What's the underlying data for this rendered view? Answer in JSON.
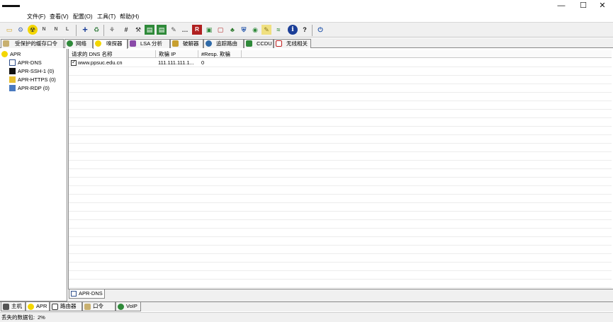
{
  "window": {
    "minimize": "—",
    "maximize": "☐",
    "close": "✕"
  },
  "menu": [
    "文件(F)",
    "查看(V)",
    "配置(O)",
    "工具(T)",
    "帮助(H)"
  ],
  "toolbar": {
    "buttons": [
      {
        "name": "open-icon",
        "glyph": "▭",
        "color": "#e8c44a"
      },
      {
        "name": "network-icon",
        "glyph": "⚙",
        "color": "#6a8cc7"
      },
      {
        "name": "sniffer-icon",
        "glyph": "☢",
        "color": "#f0d000"
      },
      {
        "name": "ntlm-auth-icon",
        "glyph": "N",
        "color": "#777777"
      },
      {
        "name": "ntlm-reset-icon",
        "glyph": "N",
        "color": "#777777"
      },
      {
        "name": "lm-reset-icon",
        "glyph": "L",
        "color": "#777777"
      },
      {
        "name": "add-icon",
        "glyph": "+",
        "color": "#1c4fa8"
      },
      {
        "name": "recycle-icon",
        "glyph": "♻",
        "color": "#2f8a3a"
      },
      {
        "name": "route-icon",
        "glyph": "⚘",
        "color": "#555555"
      },
      {
        "name": "hash-calc-icon",
        "glyph": "#",
        "color": "#333333"
      },
      {
        "name": "tool-icon-a",
        "glyph": "⚒",
        "color": "#333333"
      },
      {
        "name": "hex-icon",
        "glyph": "▤",
        "color": "#2f8a3a"
      },
      {
        "name": "hex-icon-2",
        "glyph": "▤",
        "color": "#2f8a3a"
      },
      {
        "name": "wand-icon",
        "glyph": "✎",
        "color": "#555555"
      },
      {
        "name": "dots-icon",
        "glyph": "…",
        "color": "#333333"
      },
      {
        "name": "rc-icon",
        "glyph": "R",
        "color": "#c02020"
      },
      {
        "name": "chip-icon",
        "glyph": "▣",
        "color": "#2f8a3a"
      },
      {
        "name": "monitor-icon",
        "glyph": "▢",
        "color": "#c02020"
      },
      {
        "name": "tree-icon",
        "glyph": "♣",
        "color": "#2f7a2f"
      },
      {
        "name": "shield-icon",
        "glyph": "⛨",
        "color": "#1c4fa8"
      },
      {
        "name": "cdu-icon",
        "glyph": "◉",
        "color": "#2f8a3a"
      },
      {
        "name": "edit-icon",
        "glyph": "✎",
        "color": "#555555"
      },
      {
        "name": "wireless-icon",
        "glyph": "≈",
        "color": "#2f8a3a"
      },
      {
        "name": "info-icon",
        "glyph": "i",
        "color": "#1c4fa8"
      },
      {
        "name": "help-icon",
        "glyph": "?",
        "color": "#111111"
      },
      {
        "name": "exit-icon",
        "glyph": "⏻",
        "color": "#1c4fa8"
      }
    ]
  },
  "tabs": [
    "受保护的缓存口令",
    "网络",
    "嗅探器",
    "LSA 分析",
    "破解器",
    "追踪路由",
    "CCDU",
    "无线相关"
  ],
  "tree": {
    "root": "APR",
    "items": [
      "APR-DNS",
      "APR-SSH-1 (0)",
      "APR-HTTPS (0)",
      "APR-RDP (0)"
    ]
  },
  "grid": {
    "columns": [
      "请求的 DNS 名称",
      "欺骗 IP",
      "#Resp. 欺骗"
    ],
    "rows": [
      {
        "name": "www.ppsuc.edu.cn",
        "ip": "111.111.111.1...",
        "resp": "0"
      }
    ]
  },
  "subtab": "APR-DNS",
  "bottom_tabs": [
    "主机",
    "APR",
    "路由器",
    "口令",
    "VoIP"
  ],
  "status": {
    "label": "丢失的数据包:",
    "value": "2%"
  }
}
